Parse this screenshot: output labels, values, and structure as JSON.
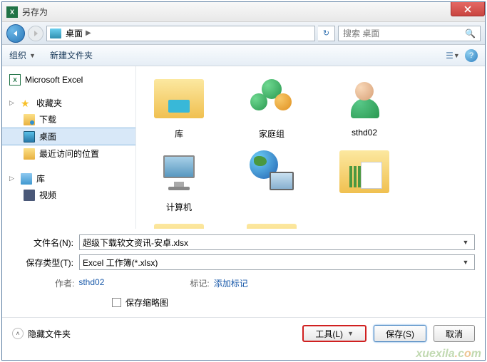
{
  "window": {
    "title": "另存为"
  },
  "navbar": {
    "location": "桌面",
    "search_placeholder": "搜索 桌面"
  },
  "toolbar": {
    "organize": "组织",
    "new_folder": "新建文件夹"
  },
  "sidebar": {
    "app": "Microsoft Excel",
    "favorites": {
      "label": "收藏夹",
      "items": [
        {
          "label": "下载"
        },
        {
          "label": "桌面"
        },
        {
          "label": "最近访问的位置"
        }
      ]
    },
    "libraries": {
      "label": "库",
      "items": [
        {
          "label": "视频"
        }
      ]
    }
  },
  "files": [
    {
      "label": "库"
    },
    {
      "label": "家庭组"
    },
    {
      "label": "sthd02"
    },
    {
      "label": "计算机"
    }
  ],
  "form": {
    "filename_label": "文件名(N):",
    "filename_value": "超级下载软文资讯-安卓.xlsx",
    "type_label": "保存类型(T):",
    "type_value": "Excel 工作簿(*.xlsx)",
    "author_label": "作者:",
    "author_value": "sthd02",
    "tags_label": "标记:",
    "tags_value": "添加标记",
    "thumbnail": "保存缩略图"
  },
  "footer": {
    "hide_folders": "隐藏文件夹",
    "tools": "工具(L)",
    "save": "保存(S)",
    "cancel": "取消"
  },
  "watermark": "xuexila.com"
}
